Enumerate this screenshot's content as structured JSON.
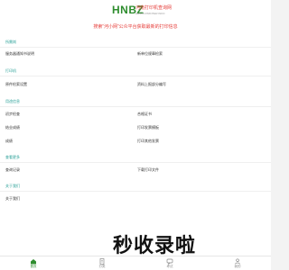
{
  "header": {
    "logo_text": "HNBZ",
    "logo_cn": "河南打印机查询网",
    "logo_en": "HENAN PRINTER INFO"
  },
  "notice": "搜索“河小网”公众平台获取最新的打印信息",
  "sections": [
    {
      "title": "所需岗",
      "items": [
        "服务器通知书说明",
        "新单位规章检索"
      ]
    },
    {
      "title": "打印机",
      "items": [
        "原件检索设置",
        "资料上报部分编写"
      ]
    },
    {
      "title": "用途信息",
      "items": [
        "初步检查",
        "合格证书",
        "结业成绩",
        "打印发票模板",
        "成绩",
        "打印其他发票"
      ]
    },
    {
      "title": "查看更多",
      "items": [
        "查询记录",
        "下载打印文件"
      ]
    },
    {
      "title": "关于我们",
      "items": [
        "关于我们"
      ]
    }
  ],
  "watermark": "秒收录啦",
  "tabs": [
    {
      "label": "首页",
      "icon": "home-icon",
      "active": true
    },
    {
      "label": "分类",
      "icon": "document-icon",
      "active": false
    },
    {
      "label": "考试",
      "icon": "message-icon",
      "active": false
    },
    {
      "label": "我的",
      "icon": "user-icon",
      "active": false
    }
  ],
  "colors": {
    "accent": "#2f8d2f",
    "notice": "#e53935",
    "section": "#2aa198"
  }
}
